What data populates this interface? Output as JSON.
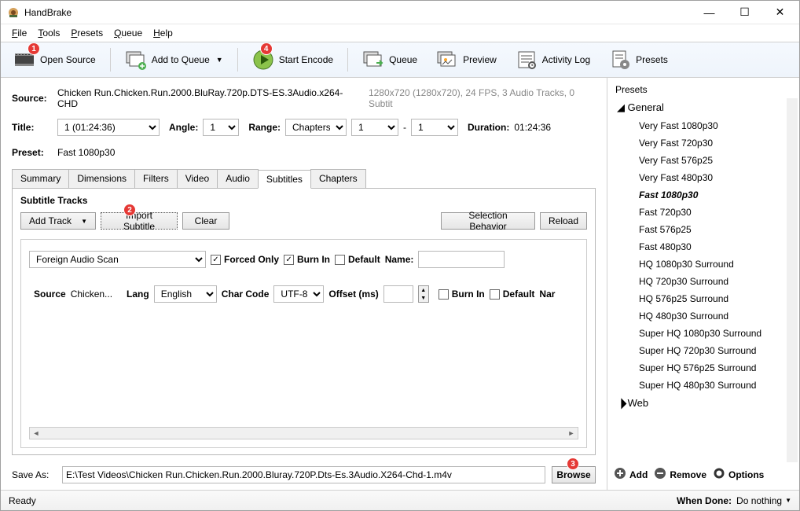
{
  "window": {
    "title": "HandBrake"
  },
  "menubar": [
    "File",
    "Tools",
    "Presets",
    "Queue",
    "Help"
  ],
  "toolbar": {
    "open_source": "Open Source",
    "add_to_queue": "Add to Queue",
    "start_encode": "Start Encode",
    "queue": "Queue",
    "preview": "Preview",
    "activity_log": "Activity Log",
    "presets": "Presets"
  },
  "badges": {
    "b1": "1",
    "b2": "2",
    "b3": "3",
    "b4": "4"
  },
  "source": {
    "label": "Source:",
    "filename": "Chicken Run.Chicken.Run.2000.BluRay.720p.DTS-ES.3Audio.x264-CHD",
    "info": "1280x720 (1280x720), 24 FPS, 3 Audio Tracks, 0 Subtit"
  },
  "title": {
    "label": "Title:",
    "value": "1  (01:24:36)",
    "angle_label": "Angle:",
    "angle_value": "1",
    "range_label": "Range:",
    "range_type": "Chapters",
    "range_from": "1",
    "range_sep": "-",
    "range_to": "1",
    "duration_label": "Duration:",
    "duration_value": "01:24:36"
  },
  "preset": {
    "label": "Preset:",
    "value": "Fast 1080p30"
  },
  "tabs": [
    "Summary",
    "Dimensions",
    "Filters",
    "Video",
    "Audio",
    "Subtitles",
    "Chapters"
  ],
  "active_tab": 5,
  "subtitles": {
    "tracks_label": "Subtitle Tracks",
    "add_track": "Add Track",
    "import_subtitle": "Import Subtitle",
    "clear": "Clear",
    "selection_behavior": "Selection Behavior",
    "reload": "Reload",
    "track_source": "Foreign Audio Scan",
    "forced_only": "Forced Only",
    "burn_in": "Burn In",
    "default": "Default",
    "name_label": "Name:",
    "row": {
      "source_label": "Source",
      "source_value": "Chicken...",
      "lang_label": "Lang",
      "lang_value": "English",
      "charcode_label": "Char Code",
      "charcode_value": "UTF-8",
      "offset_label": "Offset (ms)",
      "offset_value": "",
      "burn_in": "Burn In",
      "default": "Default",
      "nar": "Nar"
    }
  },
  "saveas": {
    "label": "Save As:",
    "path": "E:\\Test Videos\\Chicken Run.Chicken.Run.2000.Bluray.720P.Dts-Es.3Audio.X264-Chd-1.m4v",
    "browse": "Browse"
  },
  "presets_panel": {
    "title": "Presets",
    "groups": [
      {
        "name": "General",
        "expanded": true,
        "items": [
          "Very Fast 1080p30",
          "Very Fast 720p30",
          "Very Fast 576p25",
          "Very Fast 480p30",
          "Fast 1080p30",
          "Fast 720p30",
          "Fast 576p25",
          "Fast 480p30",
          "HQ 1080p30 Surround",
          "HQ 720p30 Surround",
          "HQ 576p25 Surround",
          "HQ 480p30 Surround",
          "Super HQ 1080p30 Surround",
          "Super HQ 720p30 Surround",
          "Super HQ 576p25 Surround",
          "Super HQ 480p30 Surround"
        ],
        "selected_index": 4
      },
      {
        "name": "Web",
        "expanded": false,
        "items": []
      }
    ],
    "add": "Add",
    "remove": "Remove",
    "options": "Options"
  },
  "status": {
    "ready": "Ready",
    "when_done_label": "When Done:",
    "when_done_value": "Do nothing"
  }
}
